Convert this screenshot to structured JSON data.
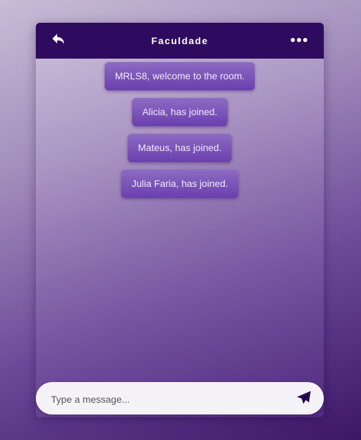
{
  "header": {
    "title": "Faculdade",
    "back_icon": "reply-arrow-icon",
    "menu_icon": "more-dots-icon"
  },
  "messages": [
    {
      "text": "MRLS8, welcome to the room."
    },
    {
      "text": "Alicia, has joined."
    },
    {
      "text": "Mateus, has joined."
    },
    {
      "text": "Julia Faria, has joined."
    }
  ],
  "composer": {
    "placeholder": "Type a message...",
    "value": "",
    "send_icon": "paper-plane-icon"
  },
  "colors": {
    "header_bg": "#2e0b5e",
    "bubble_top": "#8d6cc3",
    "bubble_bottom": "#6a3fae",
    "accent": "#2e0b5e"
  }
}
